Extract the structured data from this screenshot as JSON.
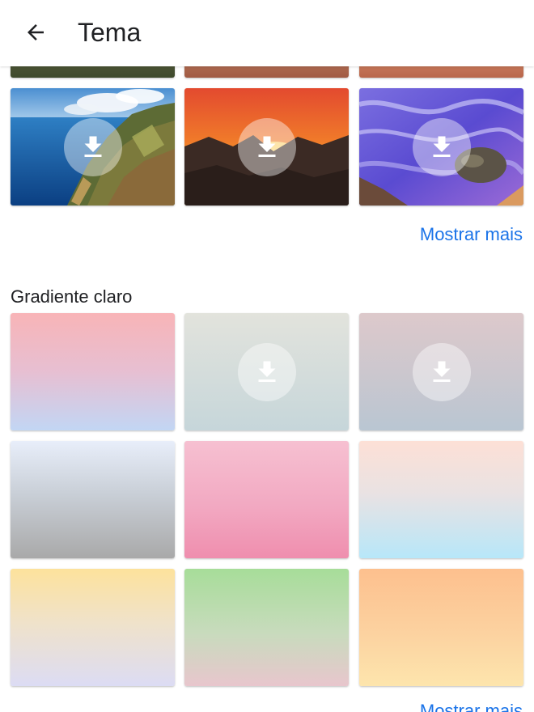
{
  "header": {
    "title": "Tema",
    "back_icon": "arrow-back-icon"
  },
  "photos_section": {
    "show_more_label": "Mostrar mais",
    "tiles": [
      {
        "subject": "coastal cliffs",
        "downloadable": true
      },
      {
        "subject": "sunset over mountains",
        "downloadable": true
      },
      {
        "subject": "purple river rocks",
        "downloadable": true
      }
    ]
  },
  "gradient_section": {
    "title": "Gradiente claro",
    "show_more_label": "Mostrar mais",
    "tiles": [
      {
        "colors": [
          "#f8b4b7",
          "#c2d6f4"
        ],
        "downloadable": false
      },
      {
        "colors": [
          "#e2e3dc",
          "#c6d6da"
        ],
        "downloadable": true
      },
      {
        "colors": [
          "#ddc9cb",
          "#b9c6d2"
        ],
        "downloadable": true
      },
      {
        "colors": [
          "#e8eefa",
          "#a9a9a9"
        ],
        "downloadable": false
      },
      {
        "colors": [
          "#f6c0d1",
          "#ef8eae"
        ],
        "downloadable": false
      },
      {
        "colors": [
          "#fde0d6",
          "#b7e7f9"
        ],
        "downloadable": false
      },
      {
        "colors": [
          "#fde29c",
          "#dcdcf4"
        ],
        "downloadable": false
      },
      {
        "colors": [
          "#a7dd99",
          "#e8c6cd"
        ],
        "downloadable": false
      },
      {
        "colors": [
          "#fdc08e",
          "#fde5ad"
        ],
        "downloadable": false
      }
    ]
  },
  "colors": {
    "accent": "#1a73e8",
    "text_primary": "#202124"
  }
}
